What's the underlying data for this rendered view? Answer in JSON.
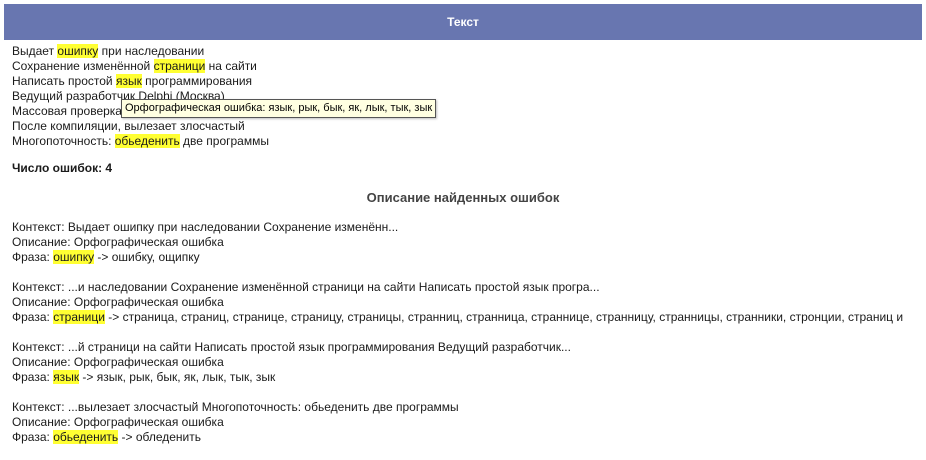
{
  "header": {
    "title": "Текст"
  },
  "text_lines": [
    {
      "before": "Выдает ",
      "hl": "ошипку",
      "after": " при наследовании"
    },
    {
      "before": "Сохранение изменённой ",
      "hl": "страници",
      "after": " на сайти"
    },
    {
      "before": "Написать простой ",
      "hl": "язык",
      "after": " программирования"
    },
    {
      "before": "Ведущий разработчик Delphi (Москва)",
      "hl": "",
      "after": ""
    },
    {
      "before": "Массовая проверка",
      "hl": "",
      "after": ""
    },
    {
      "before": "После компиляции, вылезает злосчастый",
      "hl": "",
      "after": ""
    },
    {
      "before": "Многопоточность: ",
      "hl": "обьеденить",
      "after": " две программы"
    }
  ],
  "tooltip": "Орфографическая ошибка: язык, рык, бык, як, лык, тык, зык",
  "error_count": "Число ошибок: 4",
  "section_title": "Описание найденных ошибок",
  "errors": [
    {
      "context": "Контекст: Выдает ошипку при наследовании Сохранение изменённ...",
      "description": "Описание: Орфографическая ошибка",
      "phrase_label": "Фраза: ",
      "word": "ошипку",
      "suggestions": " -> ошибку, ощипку"
    },
    {
      "context": "Контекст: ...и наследовании Сохранение изменённой страници на сайти Написать простой язык програ...",
      "description": "Описание: Орфографическая ошибка",
      "phrase_label": "Фраза: ",
      "word": "страници",
      "suggestions": " -> страница, страниц, странице, страницу, страницы, странниц, странница, страннице, странницу, странницы, странники, стронции, страниц и"
    },
    {
      "context": "Контекст: ...й страници на сайти Написать простой язык программирования Ведущий разработчик...",
      "description": "Описание: Орфографическая ошибка",
      "phrase_label": "Фраза: ",
      "word": "язык",
      "suggestions": " -> язык, рык, бык, як, лык, тык, зык"
    },
    {
      "context": "Контекст: ...вылезает злосчастый Многопоточность: обьеденить две программы",
      "description": "Описание: Орфографическая ошибка",
      "phrase_label": "Фраза: ",
      "word": "обьеденить",
      "suggestions": " -> обледенить"
    }
  ],
  "colors": {
    "header_bg": "#6876b0",
    "highlight": "#ffff33",
    "tooltip_bg": "#ffffe1"
  }
}
